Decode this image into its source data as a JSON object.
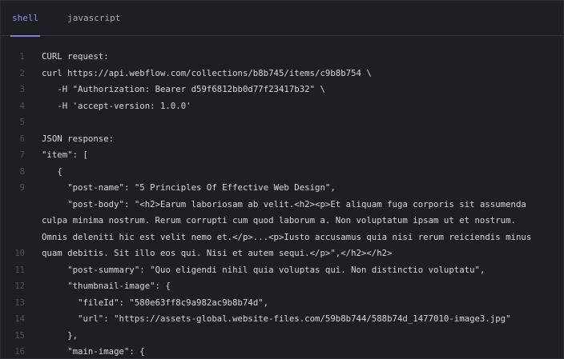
{
  "tabs": [
    {
      "label": "shell",
      "active": true
    },
    {
      "label": "javascript",
      "active": false
    }
  ],
  "colors": {
    "background": "#1d1f24",
    "active_tab": "#8b8fe6",
    "line_number": "#4f535b",
    "code_text": "#d6d8dc"
  },
  "code_lines": [
    {
      "n": "1",
      "text": "CURL request:"
    },
    {
      "n": "2",
      "text": "curl https://api.webflow.com/collections/b8b745/items/c9b8b754 \\"
    },
    {
      "n": "3",
      "text": "   -H \"Authorization: Bearer d59f6812bb0d77f23417b32\" \\"
    },
    {
      "n": "4",
      "text": "   -H 'accept-version: 1.0.0'"
    },
    {
      "n": "5",
      "text": ""
    },
    {
      "n": "6",
      "text": "JSON response:"
    },
    {
      "n": "7",
      "text": "\"item\": ["
    },
    {
      "n": "8",
      "text": "   {"
    },
    {
      "n": "9",
      "text": "     \"post-name\": \"5 Principles Of Effective Web Design\","
    },
    {
      "n": "",
      "text": "     \"post-body\": \"<h2>Earum laboriosam ab velit.<h2><p>Et aliquam fuga corporis sit assumenda"
    },
    {
      "n": "",
      "text": "culpa minima nostrum. Rerum corrupti cum quod laborum a. Non voluptatum ipsam ut et nostrum."
    },
    {
      "n": "",
      "text": "Omnis deleniti hic est velit nemo et.</p>...<p>Iusto accusamus quia nisi rerum reiciendis minus"
    },
    {
      "n": "10",
      "text": "quam debitis. Sit illo eos qui. Nisi et autem sequi.</p>\",</h2></h2>"
    },
    {
      "n": "11",
      "text": "     \"post-summary\": \"Quo eligendi nihil quia voluptas qui. Non distinctio voluptatu\","
    },
    {
      "n": "12",
      "text": "     \"thumbnail-image\": {"
    },
    {
      "n": "13",
      "text": "       \"fileId\": \"580e63ff8c9a982ac9b8b74d\","
    },
    {
      "n": "14",
      "text": "       \"url\": \"https://assets-global.website-files.com/59b8b744/588b74d_1477010-image3.jpg\""
    },
    {
      "n": "15",
      "text": "     },"
    },
    {
      "n": "16",
      "text": "     \"main-image\": {"
    }
  ]
}
